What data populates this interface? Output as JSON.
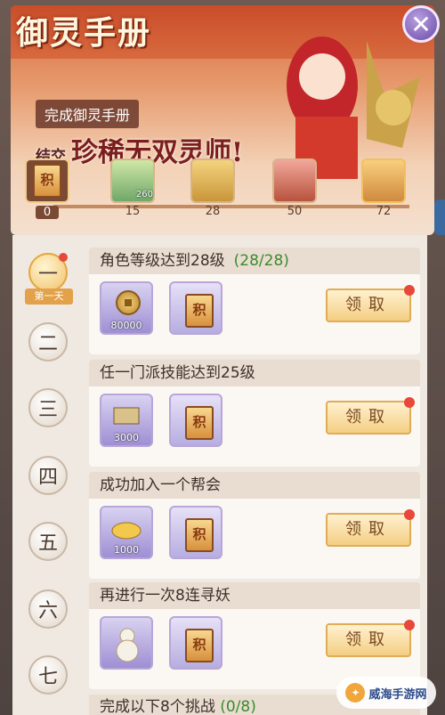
{
  "banner": {
    "title": "御灵手册",
    "subtitle": "完成御灵手册",
    "tagline_small": "结交",
    "tagline": "珍稀无双灵师!"
  },
  "progress": {
    "rewards": [
      {
        "label": "积",
        "value": "0"
      },
      {
        "badge": "260",
        "value": "15"
      },
      {
        "value": "28"
      },
      {
        "value": "50"
      },
      {
        "value": "72"
      }
    ]
  },
  "days": [
    "一",
    "二",
    "三",
    "四",
    "五",
    "六",
    "七"
  ],
  "active_day_label": "第一天",
  "tasks": [
    {
      "title": "角色等级达到28级",
      "progress": "(28/28)",
      "item1_qty": "80000",
      "item2": "积",
      "claim": "领取"
    },
    {
      "title": "任一门派技能达到25级",
      "progress": "",
      "item1_qty": "3000",
      "item2": "积",
      "claim": "领取"
    },
    {
      "title": "成功加入一个帮会",
      "progress": "",
      "item1_qty": "1000",
      "item2": "积",
      "claim": "领取"
    },
    {
      "title": "再进行一次8连寻妖",
      "progress": "",
      "item1_qty": "",
      "item2": "积",
      "claim": "领取"
    }
  ],
  "last_task": {
    "title": "完成以下8个挑战",
    "progress": "(0/8)"
  },
  "watermark": "威海手游网",
  "colors": {
    "accent": "#e4a53c",
    "banner": "#d9683e",
    "progress_green": "#3c8a2e",
    "dot": "#e6483a"
  }
}
